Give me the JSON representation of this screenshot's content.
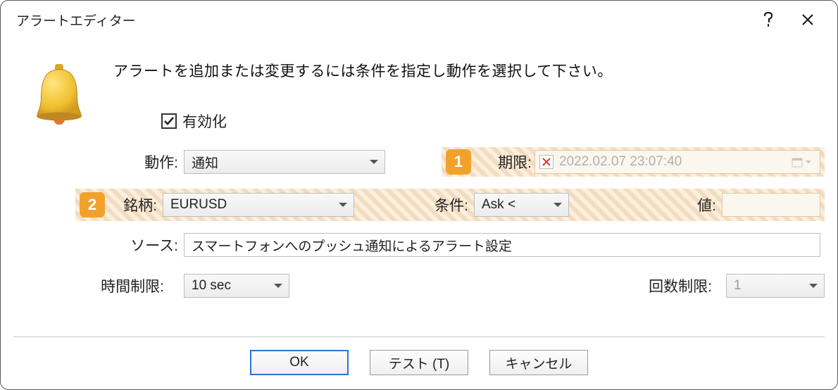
{
  "title": "アラートエディター",
  "intro": "アラートを追加または変更するには条件を指定し動作を選択して下さい。",
  "enable": {
    "label": "有効化",
    "checked": true
  },
  "labels": {
    "action": "動作:",
    "expire": "期限:",
    "symbol": "銘柄:",
    "condition": "条件:",
    "value": "値:",
    "source": "ソース:",
    "time_limit": "時間制限:",
    "count_limit": "回数制限:"
  },
  "badges": {
    "one": "1",
    "two": "2"
  },
  "values": {
    "action": "通知",
    "expire": "2022.02.07 23:07:40",
    "symbol": "EURUSD",
    "condition": "Ask <",
    "value": "",
    "source": "スマートフォンへのプッシュ通知によるアラート設定",
    "time_limit": "10 sec",
    "count_limit": "1"
  },
  "buttons": {
    "ok": "OK",
    "test": "テスト (T)",
    "cancel": "キャンセル"
  }
}
